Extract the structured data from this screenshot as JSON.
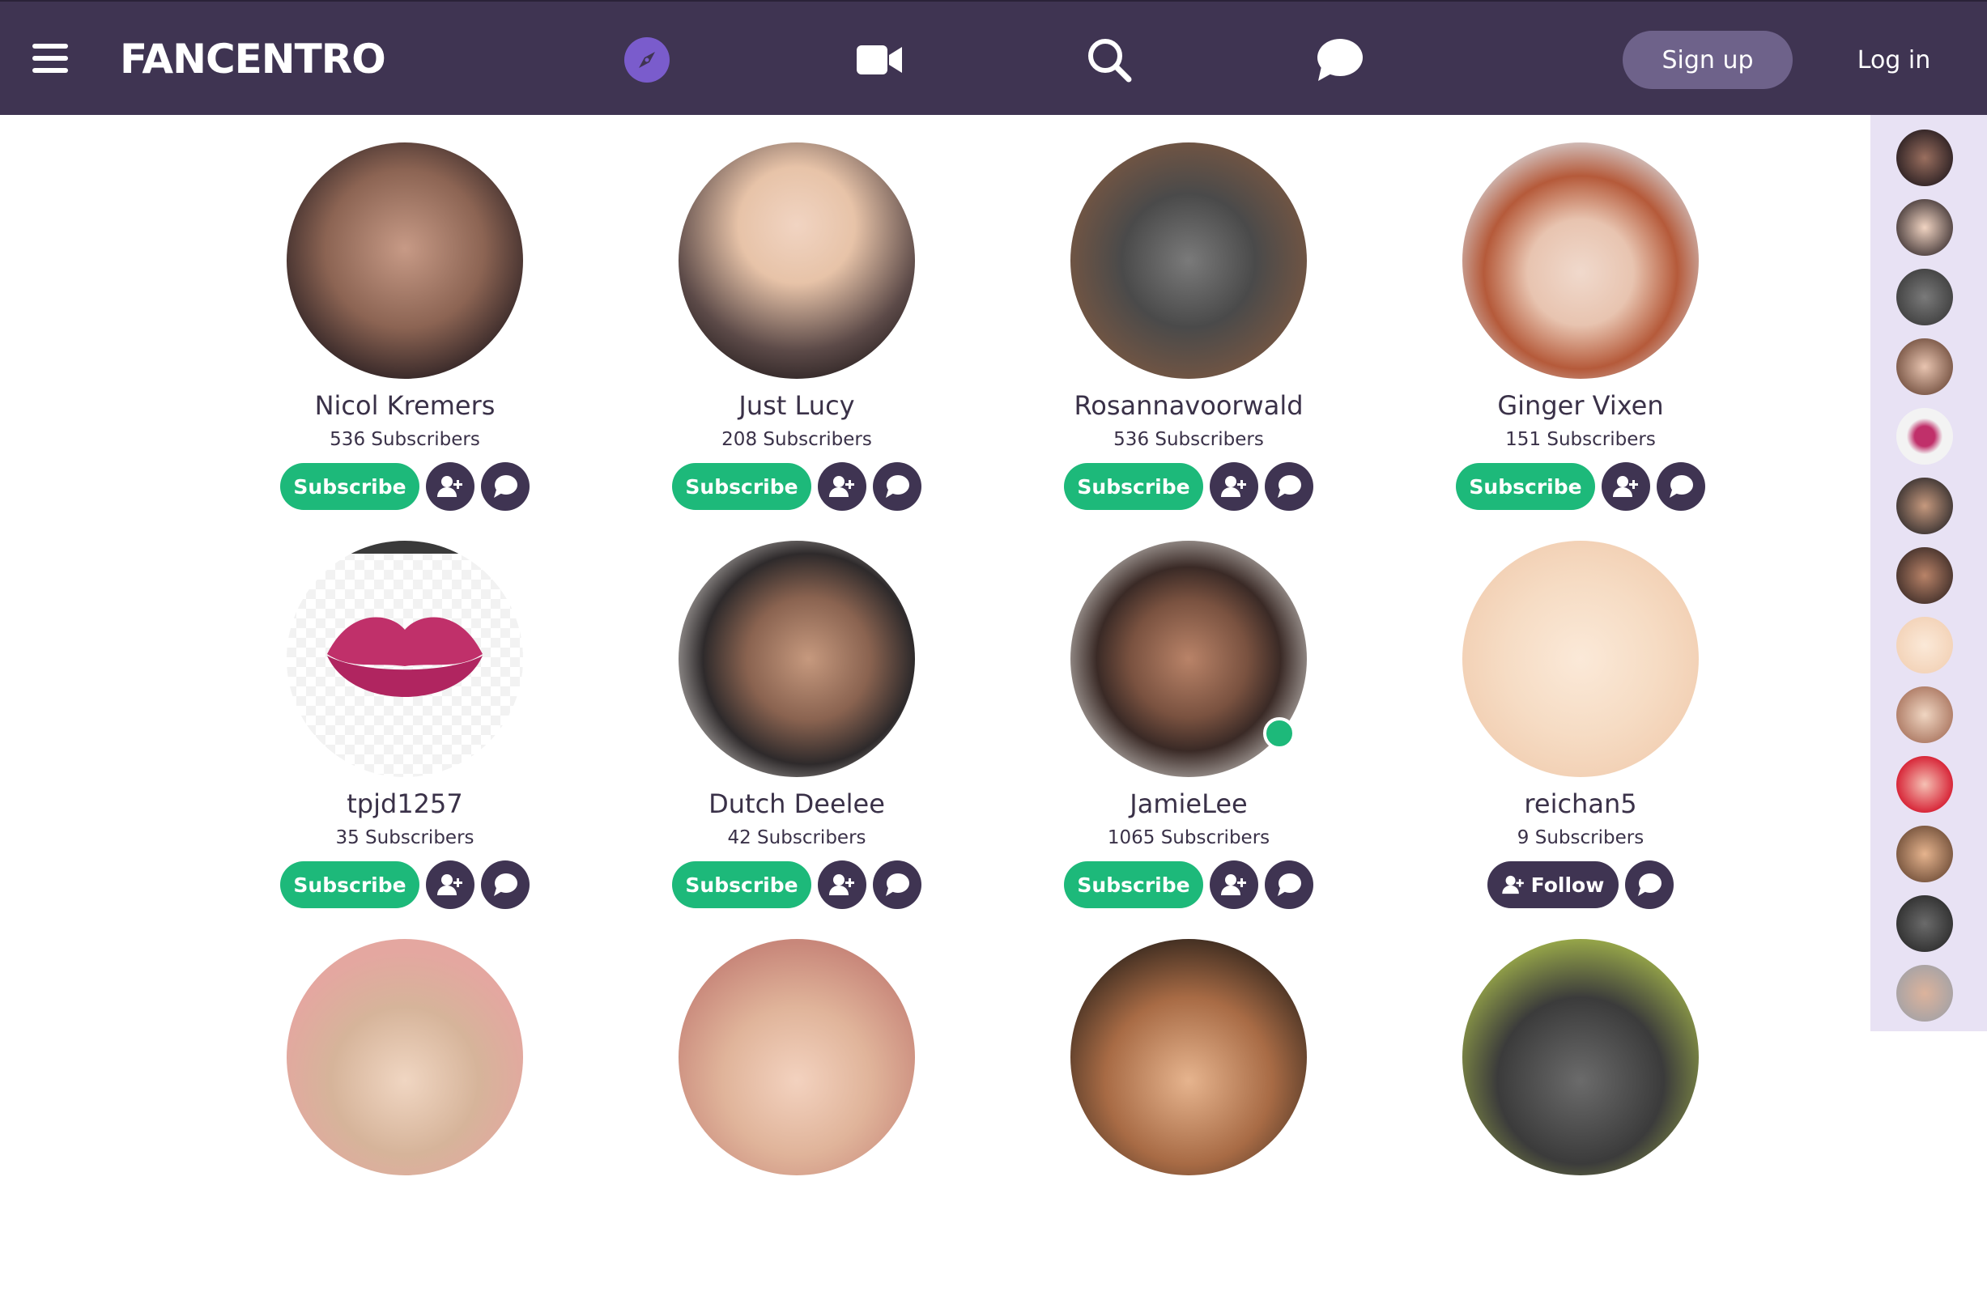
{
  "header": {
    "logo": "FANCENTRO",
    "signup_label": "Sign up",
    "login_label": "Log in",
    "accent": "#7a5ccc",
    "bg": "#3f3452"
  },
  "creators": [
    {
      "name": "Nicol Kremers",
      "subscribers": "536 Subscribers",
      "subscribe_label": "Subscribe",
      "online": false
    },
    {
      "name": "Just Lucy",
      "subscribers": "208 Subscribers",
      "subscribe_label": "Subscribe",
      "online": false
    },
    {
      "name": "Rosannavoorwald",
      "subscribers": "536 Subscribers",
      "subscribe_label": "Subscribe",
      "online": false
    },
    {
      "name": "Ginger Vixen",
      "subscribers": "151 Subscribers",
      "subscribe_label": "Subscribe",
      "online": false
    },
    {
      "name": "tpjd1257",
      "subscribers": "35 Subscribers",
      "subscribe_label": "Subscribe",
      "online": false
    },
    {
      "name": "Dutch Deelee",
      "subscribers": "42 Subscribers",
      "subscribe_label": "Subscribe",
      "online": false
    },
    {
      "name": "JamieLee",
      "subscribers": "1065 Subscribers",
      "subscribe_label": "Subscribe",
      "online": true
    },
    {
      "name": "reichan5",
      "subscribers": "9 Subscribers",
      "follow_label": "Follow",
      "online": false
    }
  ],
  "colors": {
    "subscribe": "#1db97a",
    "dark_button": "#3f3452",
    "text": "#3a3148",
    "rail_bg": "#e8e2f4"
  }
}
